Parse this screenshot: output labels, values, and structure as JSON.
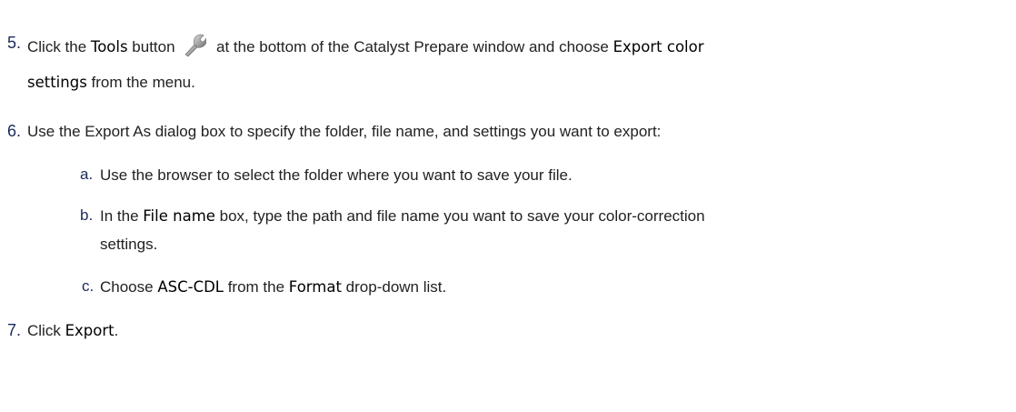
{
  "steps": {
    "s5": {
      "num": "5.",
      "p1": "Click the ",
      "tools": "Tools",
      "p2": " button ",
      "icon": "wrench-icon",
      "p3": " at the bottom of the Catalyst Prepare window and choose ",
      "export_color": "Export color",
      "settings": "settings",
      "p4": " from the menu."
    },
    "s6": {
      "num": "6.",
      "text": "Use the Export As dialog box to specify the folder, file name, and settings you want to export:",
      "a": {
        "num": "a.",
        "text": "Use the browser to select the folder where you want to save your file."
      },
      "b": {
        "num": "b.",
        "p1": "In the ",
        "file_name": "File name",
        "p2": " box, type the path and file name you want to save your color-correction",
        "p3": "settings."
      },
      "c": {
        "num": "c.",
        "p1": "Choose ",
        "asc": "ASC-CDL",
        "p2": " from the ",
        "format": "Format",
        "p3": " drop-down list."
      }
    },
    "s7": {
      "num": "7.",
      "p1": "Click ",
      "export": "Export",
      "p2": "."
    }
  }
}
